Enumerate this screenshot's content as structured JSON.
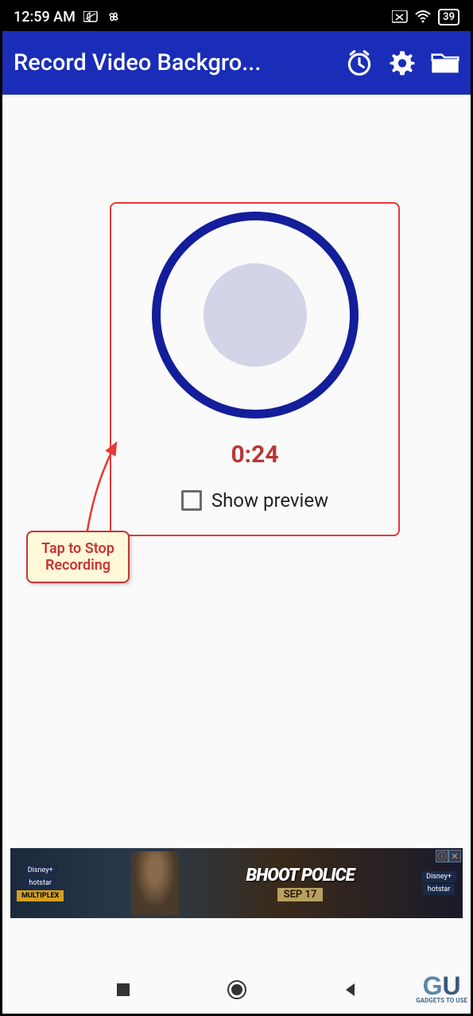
{
  "status_bar": {
    "time": "12:59 AM",
    "battery": "39"
  },
  "app_bar": {
    "title": "Record Video Backgro..."
  },
  "recorder": {
    "timer": "0:24",
    "preview_label": "Show preview"
  },
  "callout": {
    "text": "Tap to Stop Recording"
  },
  "ad": {
    "brand_top": "Disney+",
    "brand_bottom": "hotstar",
    "tag": "MULTIPLEX",
    "title": "BHOOT POLICE",
    "subtitle": "SEP 17"
  },
  "watermark": {
    "text": "GADGETS TO USE"
  }
}
